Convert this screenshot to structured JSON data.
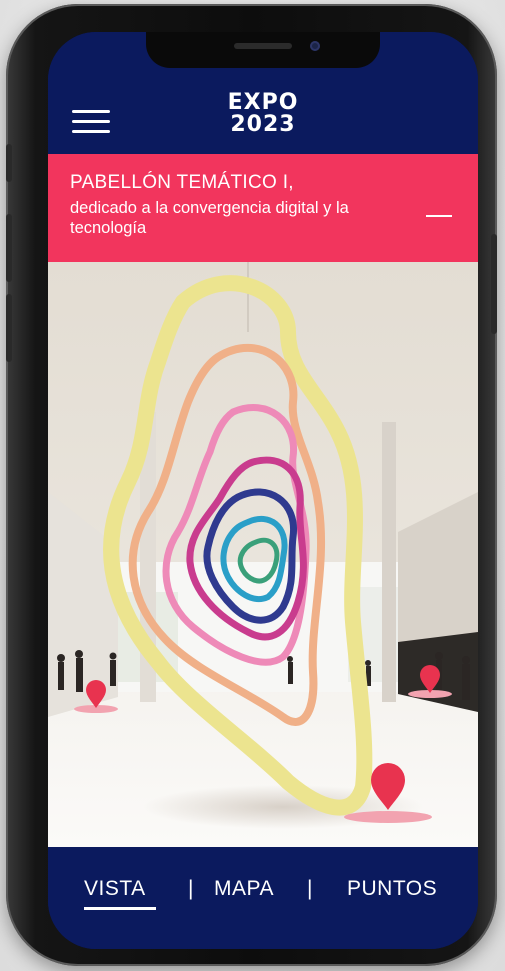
{
  "header": {
    "logo_line1": "EXPO",
    "logo_line2": "2023"
  },
  "banner": {
    "title": "PABELLÓN TEMÁTICO I,",
    "subtitle": "dedicado a la convergencia digital y la tecnología"
  },
  "bottom_nav": {
    "items": [
      {
        "label": "VISTA",
        "active": true
      },
      {
        "label": "MAPA",
        "active": false
      },
      {
        "label": "PUNTOS",
        "active": false
      }
    ],
    "separator": "|"
  },
  "colors": {
    "navy": "#0b1a5e",
    "banner_pink": "#f2355d",
    "marker_red": "#e8334f"
  },
  "icons": [
    "menu-icon",
    "collapse-icon",
    "location-pin-icon"
  ]
}
